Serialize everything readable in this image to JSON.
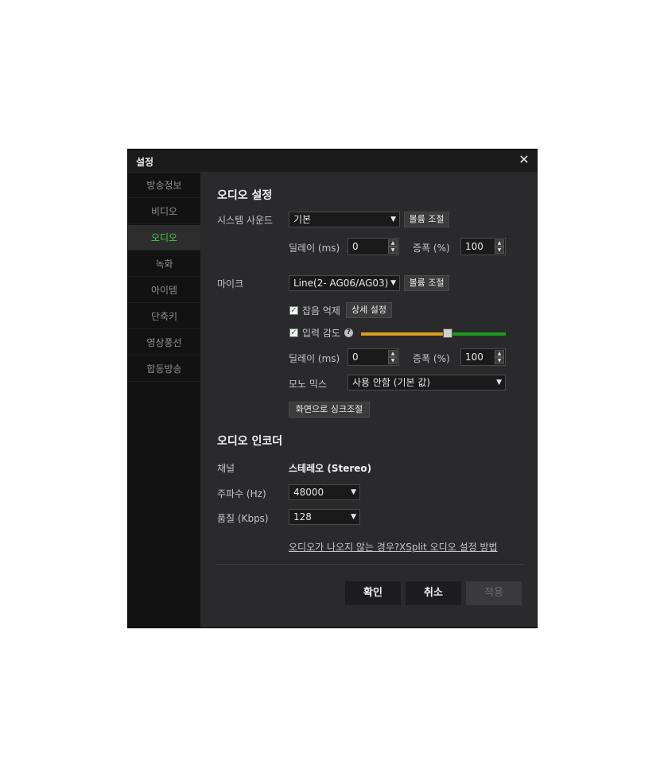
{
  "window": {
    "title": "설정"
  },
  "sidebar": {
    "items": [
      {
        "label": "방송정보"
      },
      {
        "label": "비디오"
      },
      {
        "label": "오디오"
      },
      {
        "label": "녹화"
      },
      {
        "label": "아이템"
      },
      {
        "label": "단축키"
      },
      {
        "label": "영상풍선"
      },
      {
        "label": "합동방송"
      }
    ],
    "active": "오디오"
  },
  "audio_settings": {
    "heading": "오디오 설정",
    "system_sound": {
      "label": "시스템 사운드",
      "device": "기본",
      "volume_button": "볼륨 조절",
      "delay_label": "딜레이 (ms)",
      "delay_value": "0",
      "amp_label": "증폭 (%)",
      "amp_value": "100"
    },
    "mic": {
      "label": "마이크",
      "device": "Line(2- AG06/AG03)",
      "volume_button": "볼륨 조절",
      "noise_label": "잡음 억제",
      "noise_checked": true,
      "detail_button": "상세 설정",
      "sensitivity_label": "입력 감도",
      "sensitivity_checked": true,
      "sensitivity_level": 0.6,
      "delay_label": "딜레이 (ms)",
      "delay_value": "0",
      "amp_label": "증폭 (%)",
      "amp_value": "100",
      "mono_label": "모노 믹스",
      "mono_value": "사용 안함 (기본 값)",
      "sync_button": "화면으로 싱크조절"
    }
  },
  "encoder": {
    "heading": "오디오 인코더",
    "channel_label": "채널",
    "channel_value": "스테레오 (Stereo)",
    "freq_label": "주파수 (Hz)",
    "freq_value": "48000",
    "quality_label": "품질 (Kbps)",
    "quality_value": "128",
    "link_no_audio": "오디오가 나오지 않는 경우?",
    "link_xsplit": "XSplit 오디오 설정 방법"
  },
  "footer": {
    "ok": "확인",
    "cancel": "취소",
    "apply": "적용"
  },
  "colors": {
    "accent": "#3fce3f",
    "slider_fill": "#d9a21b",
    "slider_track": "#1d9a1d"
  }
}
